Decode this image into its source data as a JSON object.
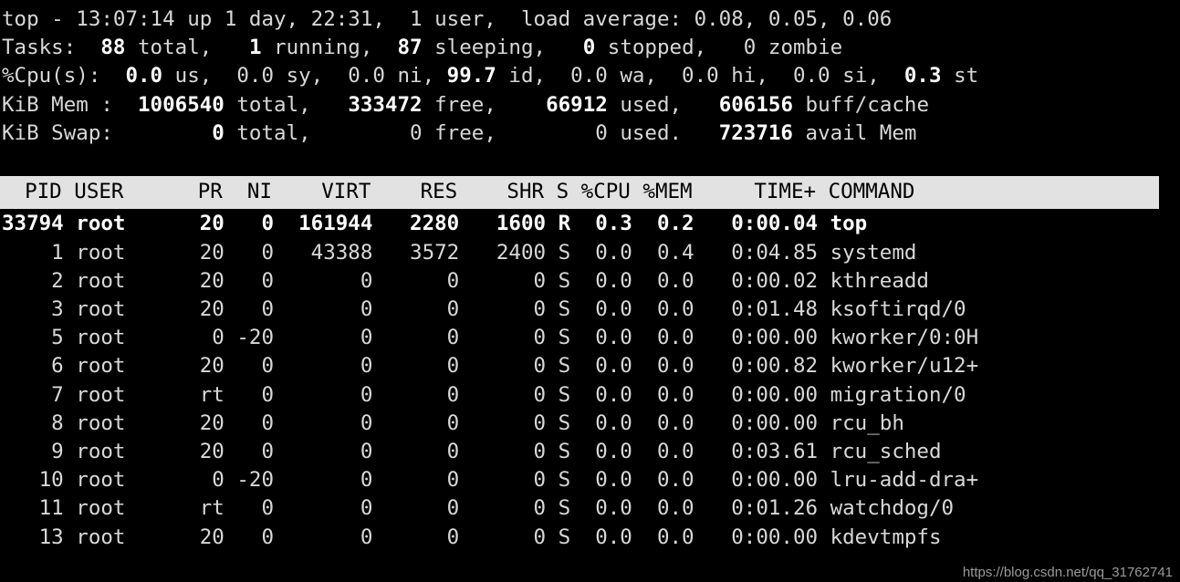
{
  "terminal": {
    "background_color": "#000000",
    "foreground_color": "#d8d8d8",
    "header_bar_bg": "#e2e2e2",
    "header_bar_fg": "#000000"
  },
  "summary": {
    "uptime_line": {
      "program": "top",
      "dash": " - ",
      "time": "13:07:14",
      "up_label": " up ",
      "uptime": "1 day, 22:31,",
      "users": "  1 user,",
      "load_label": "  load average: ",
      "load_avg_1": "0.08",
      "load_avg_5": "0.05",
      "load_avg_15": "0.06",
      "full": "top - 13:07:14 up 1 day, 22:31,  1 user,  load average: 0.08, 0.05, 0.06"
    },
    "tasks_line": {
      "label": "Tasks:",
      "total": "88",
      "total_label": " total,",
      "running": "1",
      "running_label": " running,",
      "sleeping": "87",
      "sleeping_label": " sleeping,",
      "stopped": "0",
      "stopped_label": " stopped,",
      "zombie": "0",
      "zombie_label": " zombie",
      "full": "Tasks:  88 total,   1 running,  87 sleeping,   0 stopped,   0 zombie"
    },
    "cpu_line": {
      "label": "%Cpu(s):",
      "us": "0.0",
      "us_label": " us,",
      "sy": "0.0",
      "sy_label": " sy,",
      "ni": "0.0",
      "ni_label": " ni,",
      "id": "99.7",
      "id_label": " id,",
      "wa": "0.0",
      "wa_label": " wa,",
      "hi": "0.0",
      "hi_label": " hi,",
      "si": "0.0",
      "si_label": " si,",
      "st": "0.3",
      "st_label": " st",
      "full": "%Cpu(s):  0.0 us,  0.0 sy,  0.0 ni, 99.7 id,  0.0 wa,  0.0 hi,  0.0 si,  0.3 st"
    },
    "mem_line": {
      "label": "KiB Mem :",
      "total": "1006540",
      "total_label": " total,",
      "free": "333472",
      "free_label": " free,",
      "used": "66912",
      "used_label": " used,",
      "buff_cache": "606156",
      "buff_cache_label": " buff/cache",
      "full": "KiB Mem :  1006540 total,   333472 free,    66912 used,   606156 buff/cache"
    },
    "swap_line": {
      "label": "KiB Swap:",
      "total": "0",
      "total_label": " total,",
      "free": "0",
      "free_label": " free,",
      "used": "0",
      "used_label": " used.",
      "avail": "723716",
      "avail_label": " avail Mem",
      "full": "KiB Swap:        0 total,        0 free,        0 used.   723716 avail Mem"
    }
  },
  "table": {
    "columns": [
      "PID",
      "USER",
      "PR",
      "NI",
      "VIRT",
      "RES",
      "SHR",
      "S",
      "%CPU",
      "%MEM",
      "TIME+",
      "COMMAND"
    ],
    "header_text": "  PID USER      PR  NI    VIRT    RES    SHR S %CPU %MEM     TIME+ COMMAND",
    "rows": [
      {
        "pid": "33794",
        "user": "root",
        "pr": "20",
        "ni": "0",
        "virt": "161944",
        "res": "2280",
        "shr": "1600",
        "s": "R",
        "cpu": "0.3",
        "mem": "0.2",
        "time": "0:00.04",
        "command": "top",
        "bold": true,
        "line": "33794 root      20   0  161944   2280   1600 R  0.3  0.2   0:00.04 top"
      },
      {
        "pid": "1",
        "user": "root",
        "pr": "20",
        "ni": "0",
        "virt": "43388",
        "res": "3572",
        "shr": "2400",
        "s": "S",
        "cpu": "0.0",
        "mem": "0.4",
        "time": "0:04.85",
        "command": "systemd",
        "bold": false,
        "line": "    1 root      20   0   43388   3572   2400 S  0.0  0.4   0:04.85 systemd"
      },
      {
        "pid": "2",
        "user": "root",
        "pr": "20",
        "ni": "0",
        "virt": "0",
        "res": "0",
        "shr": "0",
        "s": "S",
        "cpu": "0.0",
        "mem": "0.0",
        "time": "0:00.02",
        "command": "kthreadd",
        "bold": false,
        "line": "    2 root      20   0       0      0      0 S  0.0  0.0   0:00.02 kthreadd"
      },
      {
        "pid": "3",
        "user": "root",
        "pr": "20",
        "ni": "0",
        "virt": "0",
        "res": "0",
        "shr": "0",
        "s": "S",
        "cpu": "0.0",
        "mem": "0.0",
        "time": "0:01.48",
        "command": "ksoftirqd/0",
        "bold": false,
        "line": "    3 root      20   0       0      0      0 S  0.0  0.0   0:01.48 ksoftirqd/0"
      },
      {
        "pid": "5",
        "user": "root",
        "pr": "0",
        "ni": "-20",
        "virt": "0",
        "res": "0",
        "shr": "0",
        "s": "S",
        "cpu": "0.0",
        "mem": "0.0",
        "time": "0:00.00",
        "command": "kworker/0:0H",
        "bold": false,
        "line": "    5 root       0 -20       0      0      0 S  0.0  0.0   0:00.00 kworker/0:0H"
      },
      {
        "pid": "6",
        "user": "root",
        "pr": "20",
        "ni": "0",
        "virt": "0",
        "res": "0",
        "shr": "0",
        "s": "S",
        "cpu": "0.0",
        "mem": "0.0",
        "time": "0:00.82",
        "command": "kworker/u12+",
        "bold": false,
        "line": "    6 root      20   0       0      0      0 S  0.0  0.0   0:00.82 kworker/u12+"
      },
      {
        "pid": "7",
        "user": "root",
        "pr": "rt",
        "ni": "0",
        "virt": "0",
        "res": "0",
        "shr": "0",
        "s": "S",
        "cpu": "0.0",
        "mem": "0.0",
        "time": "0:00.00",
        "command": "migration/0",
        "bold": false,
        "line": "    7 root      rt   0       0      0      0 S  0.0  0.0   0:00.00 migration/0"
      },
      {
        "pid": "8",
        "user": "root",
        "pr": "20",
        "ni": "0",
        "virt": "0",
        "res": "0",
        "shr": "0",
        "s": "S",
        "cpu": "0.0",
        "mem": "0.0",
        "time": "0:00.00",
        "command": "rcu_bh",
        "bold": false,
        "line": "    8 root      20   0       0      0      0 S  0.0  0.0   0:00.00 rcu_bh"
      },
      {
        "pid": "9",
        "user": "root",
        "pr": "20",
        "ni": "0",
        "virt": "0",
        "res": "0",
        "shr": "0",
        "s": "S",
        "cpu": "0.0",
        "mem": "0.0",
        "time": "0:03.61",
        "command": "rcu_sched",
        "bold": false,
        "line": "    9 root      20   0       0      0      0 S  0.0  0.0   0:03.61 rcu_sched"
      },
      {
        "pid": "10",
        "user": "root",
        "pr": "0",
        "ni": "-20",
        "virt": "0",
        "res": "0",
        "shr": "0",
        "s": "S",
        "cpu": "0.0",
        "mem": "0.0",
        "time": "0:00.00",
        "command": "lru-add-dra+",
        "bold": false,
        "line": "   10 root       0 -20       0      0      0 S  0.0  0.0   0:00.00 lru-add-dra+"
      },
      {
        "pid": "11",
        "user": "root",
        "pr": "rt",
        "ni": "0",
        "virt": "0",
        "res": "0",
        "shr": "0",
        "s": "S",
        "cpu": "0.0",
        "mem": "0.0",
        "time": "0:01.26",
        "command": "watchdog/0",
        "bold": false,
        "line": "   11 root      rt   0       0      0      0 S  0.0  0.0   0:01.26 watchdog/0"
      },
      {
        "pid": "13",
        "user": "root",
        "pr": "20",
        "ni": "0",
        "virt": "0",
        "res": "0",
        "shr": "0",
        "s": "S",
        "cpu": "0.0",
        "mem": "0.0",
        "time": "0:00.00",
        "command": "kdevtmpfs",
        "bold": false,
        "line": "   13 root      20   0       0      0      0 S  0.0  0.0   0:00.00 kdevtmpfs"
      }
    ]
  },
  "watermark": {
    "text": "https://blog.csdn.net/qq_31762741"
  }
}
